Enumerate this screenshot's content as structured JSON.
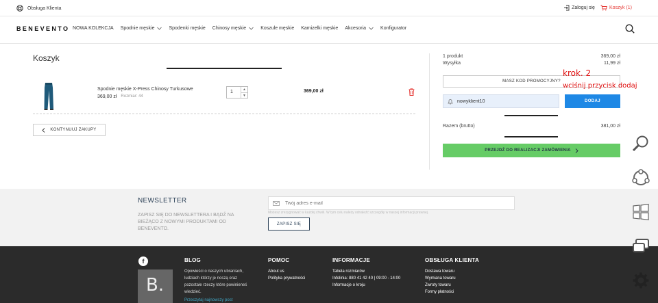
{
  "topbar": {
    "support_label": "Obsługa Klienta",
    "login_label": "Zaloguj się",
    "cart_label": "Koszyk (1)"
  },
  "nav": {
    "logo": "BENEVENTO",
    "items": [
      {
        "label": "NOWA KOLEKCJA",
        "dropdown": false
      },
      {
        "label": "Spodnie męskie",
        "dropdown": true
      },
      {
        "label": "Spodenki męskie",
        "dropdown": false
      },
      {
        "label": "Chinosy męskie",
        "dropdown": true
      },
      {
        "label": "Koszule męskie",
        "dropdown": false
      },
      {
        "label": "Kamizelki męskie",
        "dropdown": false
      },
      {
        "label": "Akcesoria",
        "dropdown": true
      },
      {
        "label": "Konfigurator",
        "dropdown": false
      }
    ]
  },
  "cart": {
    "title": "Koszyk",
    "item": {
      "name": "Spodnie męskie X-Press Chinosy Turkusowe",
      "price": "369,00 zł",
      "size_label": "Rozmiar: 44",
      "quantity": "1",
      "line_total": "369,00 zł"
    },
    "continue_label": "KONTYNUUJ ZAKUPY"
  },
  "summary": {
    "products_label": "1 produkt",
    "products_value": "369,00 zł",
    "shipping_label": "Wysyłka",
    "shipping_value": "11,99 zł",
    "promo_button": "MASZ KOD PROMOCYJNY?",
    "promo_code": "nowyklient10",
    "add_button": "DODAJ",
    "total_label": "Razem (brutto)",
    "total_value": "381,00 zł",
    "checkout_button": "PRZEJDŹ DO REALIZACJI ZAMÓWIENIA"
  },
  "annotation": {
    "line1": "krok. 2",
    "line2": "wciśnij przycisk dodaj",
    "color": "#e01010"
  },
  "newsletter": {
    "title": "NEWSLETTER",
    "description": "ZAPISZ SIĘ DO NEWSLETTERA I BĄDŹ NA BIEŻĄCO Z NOWYMI PRODUKTAMI OD BENEVENTO.",
    "email_placeholder": "Twój adres e-mail",
    "note": "Możesz zrezygnować w każdej chwili. W tym celu należy odnaleźć szczegóły w naszej informacji prawnej.",
    "subscribe_button": "ZAPISZ SIĘ"
  },
  "footer": {
    "facebook_glyph": "f",
    "blog": {
      "title": "BLOG",
      "text": "Opowieści o naszych ubraniach, ludziach którzy je noszą oraz pozostałe rzeczy które powinieneś wiedzieć.",
      "link": "Przeczytaj najnowszy post",
      "thumb_letter": "B."
    },
    "pomoc": {
      "title": "POMOC",
      "links": [
        "About us",
        "Polityka prywatności"
      ]
    },
    "informacje": {
      "title": "INFORMACJE",
      "links": [
        "Tabela rozmiarów",
        "Infolinia: 880 41 42 40 | 09:00 - 14:00",
        "Informacje o kroju"
      ]
    },
    "obsluga": {
      "title": "OBSŁUGA KLIENTA",
      "links": [
        "Dostawa towaru",
        "Wymiana towaru",
        "Zwroty towaru",
        "Formy płatności"
      ]
    }
  },
  "colors": {
    "accent_blue": "#1e88e5",
    "checkout_green": "#66cc66",
    "cart_red": "#e53935",
    "footer_bg": "#2b2b2b"
  }
}
